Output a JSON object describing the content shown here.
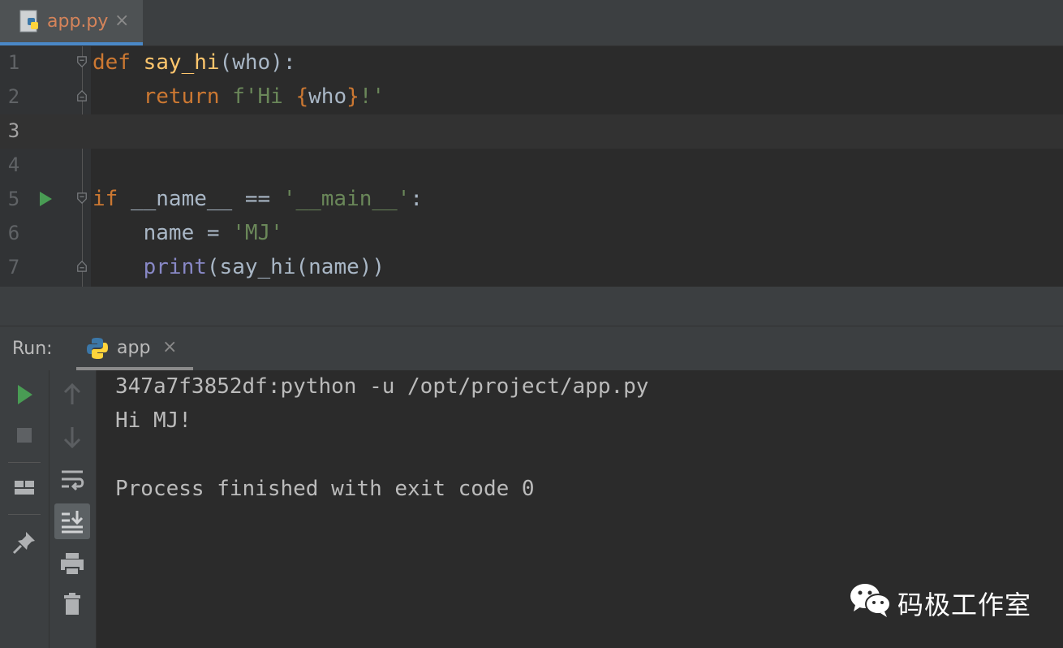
{
  "editor": {
    "tab": {
      "label": "app.py",
      "close": "×"
    },
    "lines": [
      {
        "num": "1",
        "tokens": [
          {
            "t": "def",
            "c": "kw"
          },
          {
            "t": " "
          },
          {
            "t": "say_hi",
            "c": "fn"
          },
          {
            "t": "(who):"
          }
        ]
      },
      {
        "num": "2",
        "tokens": [
          {
            "t": "    "
          },
          {
            "t": "return",
            "c": "kw"
          },
          {
            "t": " "
          },
          {
            "t": "f'Hi ",
            "c": "str"
          },
          {
            "t": "{",
            "c": "brace"
          },
          {
            "t": "who"
          },
          {
            "t": "}",
            "c": "brace"
          },
          {
            "t": "!'",
            "c": "str"
          }
        ]
      },
      {
        "num": "3",
        "tokens": []
      },
      {
        "num": "4",
        "tokens": []
      },
      {
        "num": "5",
        "tokens": [
          {
            "t": "if",
            "c": "kw"
          },
          {
            "t": " __name__ == "
          },
          {
            "t": "'__main__'",
            "c": "str"
          },
          {
            "t": ":"
          }
        ]
      },
      {
        "num": "6",
        "tokens": [
          {
            "t": "    name = "
          },
          {
            "t": "'MJ'",
            "c": "str"
          }
        ]
      },
      {
        "num": "7",
        "tokens": [
          {
            "t": "    "
          },
          {
            "t": "print",
            "c": "builtin"
          },
          {
            "t": "(say_hi(name))"
          }
        ]
      }
    ],
    "current_line": 3
  },
  "run": {
    "label": "Run:",
    "tab": {
      "label": "app",
      "close": "×"
    },
    "toolbar_left": [
      "run-icon",
      "stop-icon",
      "layout-icon",
      "pin-icon"
    ],
    "toolbar_right": [
      "arrow-up-icon",
      "arrow-down-icon",
      "soft-wrap-icon",
      "scroll-to-end-icon",
      "print-icon",
      "trash-icon"
    ],
    "console": {
      "command": "347a7f3852df:python -u /opt/project/app.py",
      "output": "Hi MJ!",
      "finished": "Process finished with exit code 0"
    }
  },
  "watermark": {
    "text": "码极工作室"
  },
  "colors": {
    "keyword": "#cc7832",
    "function": "#ffc66d",
    "string": "#6a8759",
    "builtin": "#8888c6",
    "run_green": "#499c54",
    "tab_accent": "#4a88c7"
  }
}
